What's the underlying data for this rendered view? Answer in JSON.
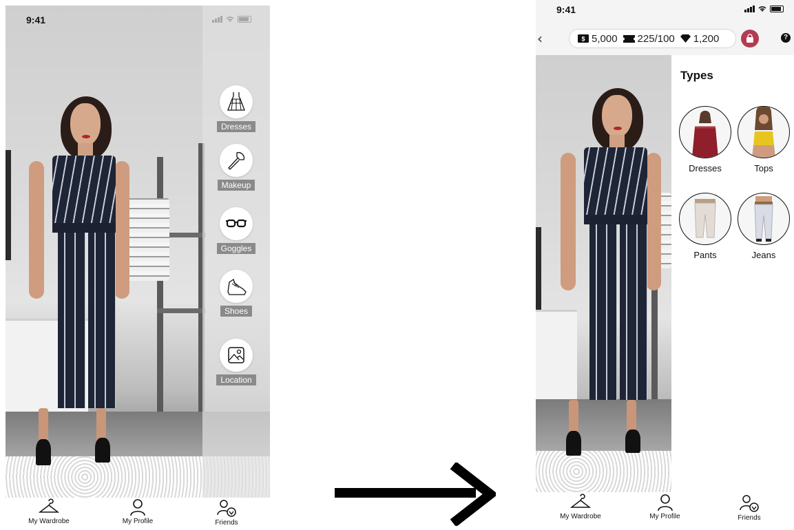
{
  "screen_before": {
    "status_time": "9:41",
    "categories": [
      {
        "label": "Dresses",
        "icon": "dress-icon"
      },
      {
        "label": "Makeup",
        "icon": "makeup-brush-icon"
      },
      {
        "label": "Goggles",
        "icon": "glasses-icon"
      },
      {
        "label": "Shoes",
        "icon": "sneaker-icon"
      },
      {
        "label": "Location",
        "icon": "image-icon"
      }
    ],
    "nav": [
      {
        "label": "My Wardrobe",
        "icon": "hanger-icon"
      },
      {
        "label": "My Profile",
        "icon": "person-icon"
      },
      {
        "label": "Friends",
        "icon": "friends-icon"
      }
    ]
  },
  "screen_after": {
    "status_time": "9:41",
    "currency": {
      "cash": "5,000",
      "tickets": "225/100",
      "gems": "1,200"
    },
    "help": "?",
    "types_title": "Types",
    "types": [
      {
        "label": "Dresses",
        "color": "#8e1f2b"
      },
      {
        "label": "Tops",
        "color": "#e8c51e"
      },
      {
        "label": "Pants",
        "color": "#e3dcd6"
      },
      {
        "label": "Jeans",
        "color": "#d9dce4"
      }
    ],
    "nav": [
      {
        "label": "My Wardrobe",
        "icon": "hanger-icon"
      },
      {
        "label": "My Profile",
        "icon": "person-icon"
      },
      {
        "label": "Friends",
        "icon": "friends-icon"
      }
    ]
  },
  "colors": {
    "bag_accent": "#b33b52",
    "label_bg": "#8a8a8a"
  }
}
